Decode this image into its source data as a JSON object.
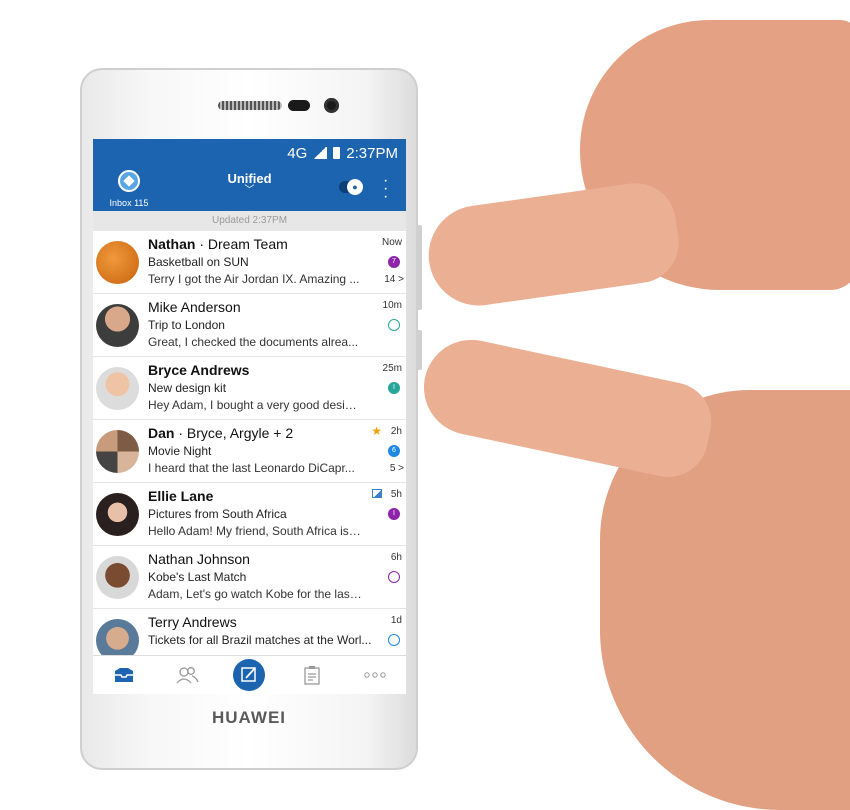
{
  "device": {
    "brand": "HUAWEI"
  },
  "status_bar": {
    "network": "4G",
    "time": "2:37PM"
  },
  "app_bar": {
    "inbox_label": "Inbox",
    "inbox_count": "115",
    "title": "Unified"
  },
  "updated_text": "Updated 2:37PM",
  "colors": {
    "accent": "#1d64b0",
    "purple": "#8e24aa",
    "teal": "#26a69a",
    "blue": "#1e88e5"
  },
  "messages": [
    {
      "sender": "Nathan",
      "group": "Dream Team",
      "subject": "Basketball on SUN",
      "preview": "Terry I got the Air Jordan IX. Amazing ...",
      "time": "Now",
      "badge": "7",
      "count": "14 >"
    },
    {
      "sender": "Mike Anderson",
      "subject": "Trip to London",
      "preview": "Great, I checked the documents alrea...",
      "time": "10m"
    },
    {
      "sender": "Bryce Andrews",
      "subject": "New design kit",
      "preview": "Hey Adam, I bought a very good design...",
      "time": "25m"
    },
    {
      "sender": "Dan",
      "group": "Bryce, Argyle + 2",
      "subject": "Movie Night",
      "preview": "I heard that the last Leonardo DiCapr...",
      "time": "2h",
      "badge": "6",
      "count": "5 >"
    },
    {
      "sender": "Ellie Lane",
      "subject": "Pictures from South Africa",
      "preview": "Hello Adam! My friend, South Africa is inc...",
      "time": "5h"
    },
    {
      "sender": "Nathan Johnson",
      "subject": "Kobe's Last Match",
      "preview": "Adam, Let's go watch Kobe for the last ti...",
      "time": "6h"
    },
    {
      "sender": "Terry Andrews",
      "subject": "Tickets for all Brazil matches at the Worl...",
      "preview": "",
      "time": "1d"
    }
  ],
  "tabs": [
    "inbox-icon",
    "people-icon",
    "compose-icon",
    "clipboard-icon",
    "more-icon"
  ]
}
